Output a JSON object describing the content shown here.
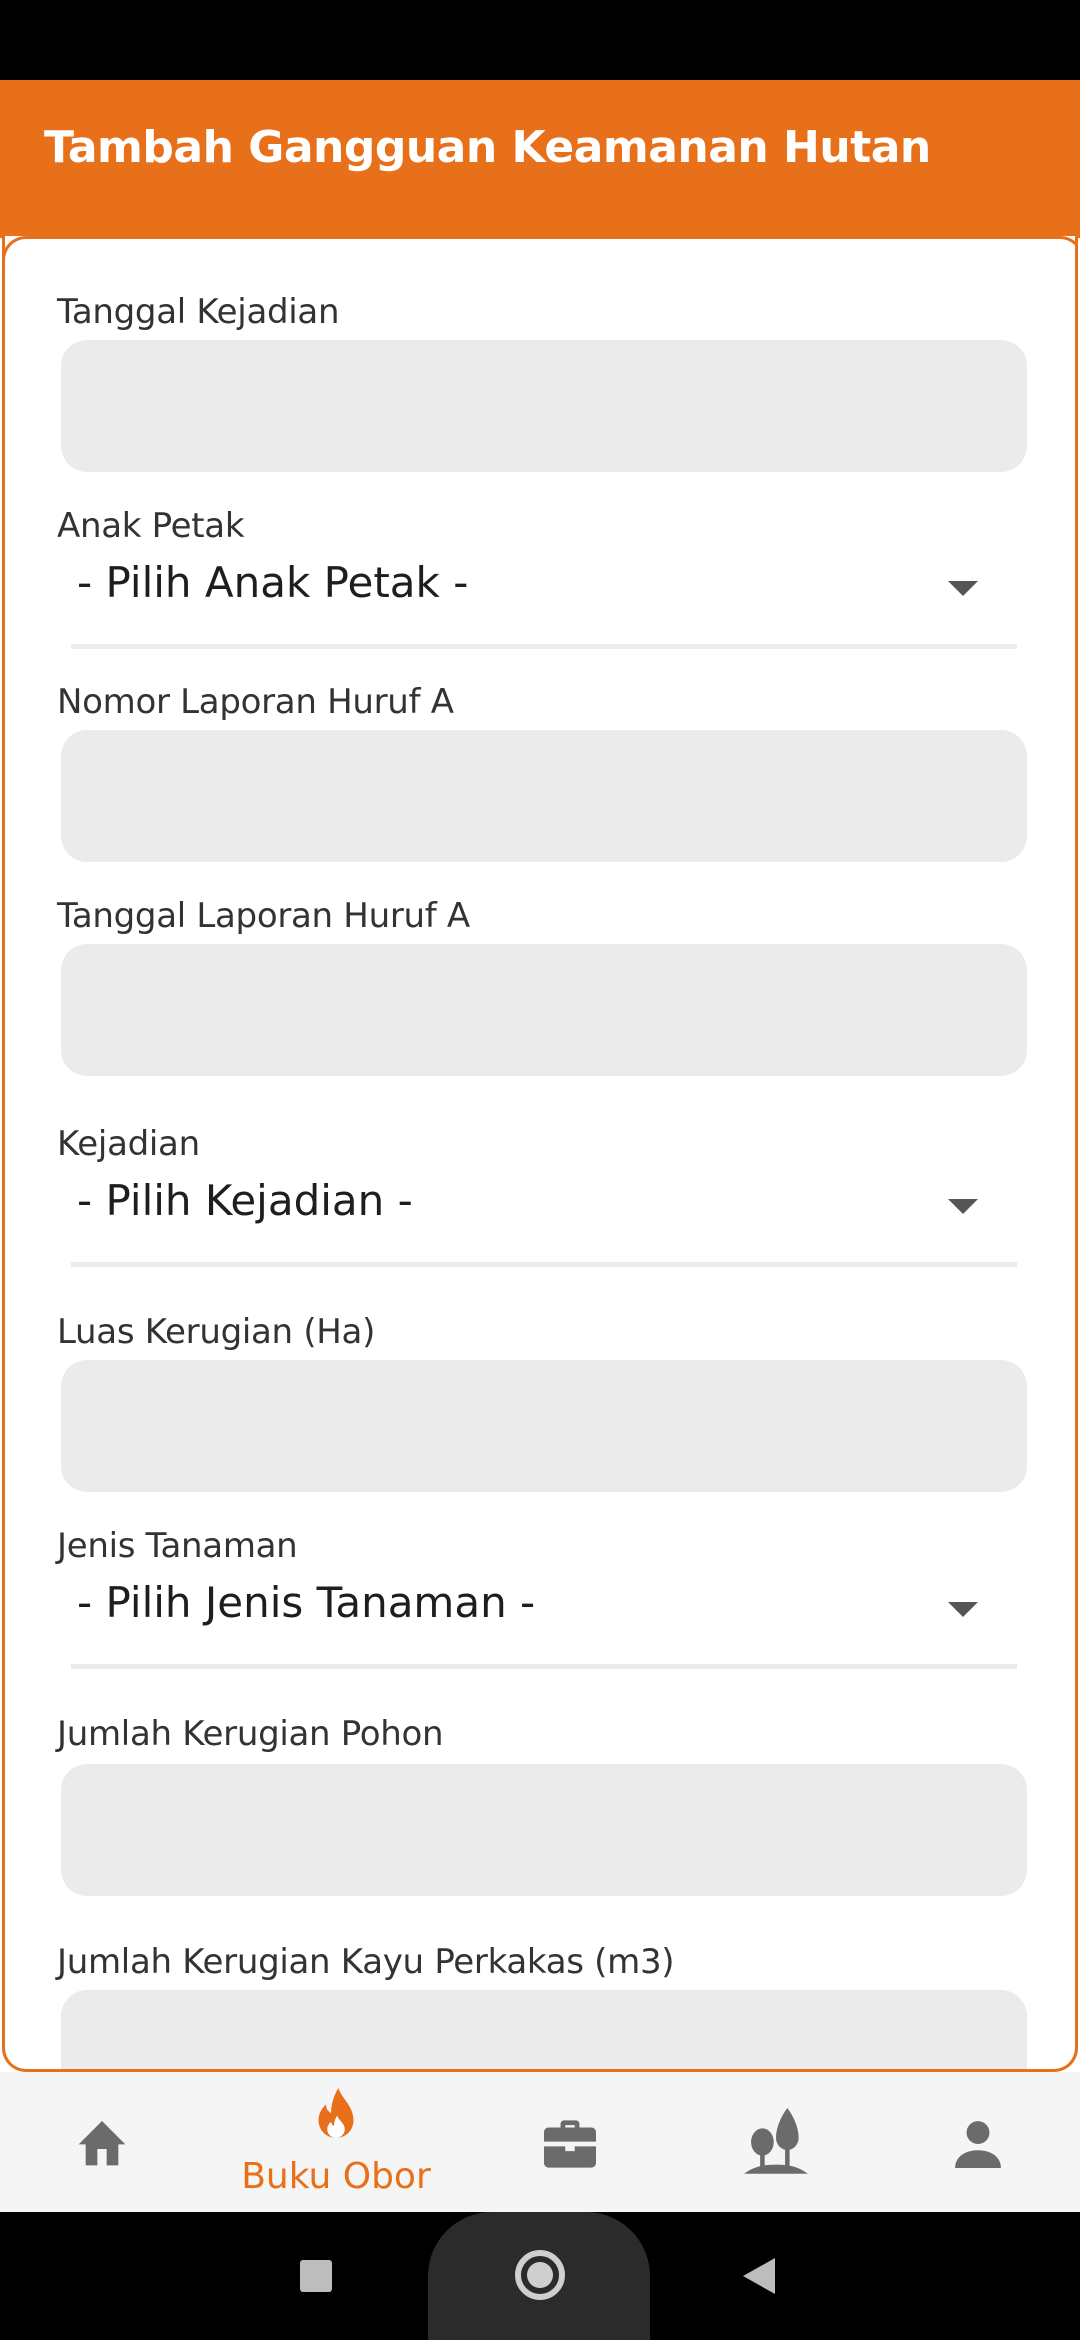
{
  "app_bar": {
    "title": "Tambah Gangguan Keamanan Hutan"
  },
  "form": {
    "fields": [
      {
        "label": "Tanggal Kejadian",
        "type": "text",
        "value": ""
      },
      {
        "label": "Anak Petak",
        "type": "select",
        "value": "- Pilih Anak Petak -"
      },
      {
        "label": "Nomor Laporan Huruf A",
        "type": "text",
        "value": ""
      },
      {
        "label": "Tanggal Laporan Huruf A",
        "type": "text",
        "value": ""
      },
      {
        "label": "Kejadian",
        "type": "select",
        "value": "- Pilih Kejadian -"
      },
      {
        "label": "Luas Kerugian (Ha)",
        "type": "text",
        "value": ""
      },
      {
        "label": "Jenis Tanaman",
        "type": "select",
        "value": "- Pilih Jenis Tanaman -"
      },
      {
        "label": "Jumlah Kerugian Pohon",
        "type": "text",
        "value": ""
      },
      {
        "label": "Jumlah Kerugian Kayu Perkakas (m3)",
        "type": "text",
        "value": ""
      }
    ]
  },
  "bottom_nav": {
    "items": [
      {
        "icon": "home-icon",
        "label": "",
        "active": false
      },
      {
        "icon": "flame-icon",
        "label": "Buku Obor",
        "active": true
      },
      {
        "icon": "briefcase-icon",
        "label": "",
        "active": false
      },
      {
        "icon": "trees-icon",
        "label": "",
        "active": false
      },
      {
        "icon": "person-icon",
        "label": "",
        "active": false
      }
    ]
  },
  "colors": {
    "accent": "#e8701a",
    "input_bg": "#ebebeb",
    "nav_icon": "#6b6b6b",
    "nav_bg": "#f5f5f5"
  }
}
